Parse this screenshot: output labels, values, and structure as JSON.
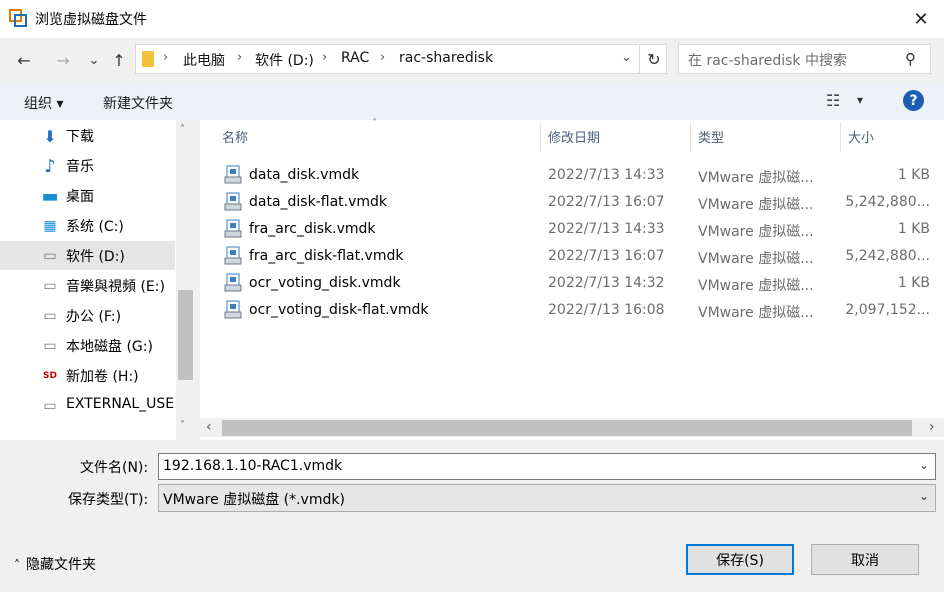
{
  "window": {
    "title": "浏览虚拟磁盘文件",
    "close_glyph": "✕"
  },
  "nav_buttons": {
    "back_glyph": "←",
    "forward_glyph": "→",
    "recent_glyph": "⌄",
    "up_glyph": "↑"
  },
  "address": {
    "crumbs": [
      "此电脑",
      "软件 (D:)",
      "RAC",
      "rac-sharedisk"
    ],
    "sep_glyph": "›",
    "dropdown_glyph": "⌄",
    "refresh_glyph": "↻"
  },
  "search": {
    "placeholder": "在 rac-sharedisk 中搜索",
    "icon_glyph": "⚲"
  },
  "toolbar": {
    "organize_label": "组织 ▾",
    "new_folder_label": "新建文件夹",
    "view_glyph": "☷",
    "view_dropdown_glyph": "▾",
    "help_glyph": "?"
  },
  "nav_pane": {
    "items": [
      {
        "label": "下载",
        "icon": "download-icon",
        "glyph": "⬇",
        "selected": false
      },
      {
        "label": "音乐",
        "icon": "music-icon",
        "glyph": "♪",
        "selected": false
      },
      {
        "label": "桌面",
        "icon": "desktop-icon",
        "glyph": "▬",
        "selected": false
      },
      {
        "label": "系统 (C:)",
        "icon": "windows-drive-icon",
        "glyph": "▦",
        "selected": false
      },
      {
        "label": "软件 (D:)",
        "icon": "drive-icon",
        "glyph": "▭",
        "selected": true
      },
      {
        "label": "音樂與視頻 (E:)",
        "icon": "drive-icon",
        "glyph": "▭",
        "selected": false
      },
      {
        "label": "办公 (F:)",
        "icon": "drive-icon",
        "glyph": "▭",
        "selected": false
      },
      {
        "label": "本地磁盘 (G:)",
        "icon": "drive-icon",
        "glyph": "▭",
        "selected": false
      },
      {
        "label": "新加卷 (H:)",
        "icon": "sd-card-icon",
        "glyph": "SD",
        "selected": false
      },
      {
        "label": "EXTERNAL_USE",
        "icon": "drive-icon",
        "glyph": "▭",
        "selected": false
      }
    ],
    "scroll_up_glyph": "˄",
    "scroll_down_glyph": "˅"
  },
  "file_list": {
    "columns": [
      "名称",
      "修改日期",
      "类型",
      "大小"
    ],
    "sort_glyph": "˄",
    "rows": [
      {
        "name": "data_disk.vmdk",
        "date": "2022/7/13 14:33",
        "type": "VMware 虚拟磁...",
        "size": "1 KB"
      },
      {
        "name": "data_disk-flat.vmdk",
        "date": "2022/7/13 16:07",
        "type": "VMware 虚拟磁...",
        "size": "5,242,880..."
      },
      {
        "name": "fra_arc_disk.vmdk",
        "date": "2022/7/13 14:33",
        "type": "VMware 虚拟磁...",
        "size": "1 KB"
      },
      {
        "name": "fra_arc_disk-flat.vmdk",
        "date": "2022/7/13 16:07",
        "type": "VMware 虚拟磁...",
        "size": "5,242,880..."
      },
      {
        "name": "ocr_voting_disk.vmdk",
        "date": "2022/7/13 14:32",
        "type": "VMware 虚拟磁...",
        "size": "1 KB"
      },
      {
        "name": "ocr_voting_disk-flat.vmdk",
        "date": "2022/7/13 16:08",
        "type": "VMware 虚拟磁...",
        "size": "2,097,152..."
      }
    ],
    "scroll_left_glyph": "‹",
    "scroll_right_glyph": "›"
  },
  "filename": {
    "label": "文件名(N):",
    "value": "192.168.1.10-RAC1.vmdk",
    "dropdown_glyph": "⌄"
  },
  "filetype": {
    "label": "保存类型(T):",
    "value": "VMware 虚拟磁盘 (*.vmdk)",
    "dropdown_glyph": "⌄"
  },
  "footer": {
    "hide_folders_label": "隐藏文件夹",
    "hide_folders_glyph": "˄",
    "save_label": "保存(S)",
    "cancel_label": "取消"
  },
  "colors": {
    "accent": "#0078d7",
    "selection": "#e5e5e5",
    "toolbar_bg": "#eef1f8",
    "header_text": "#4c607a"
  }
}
